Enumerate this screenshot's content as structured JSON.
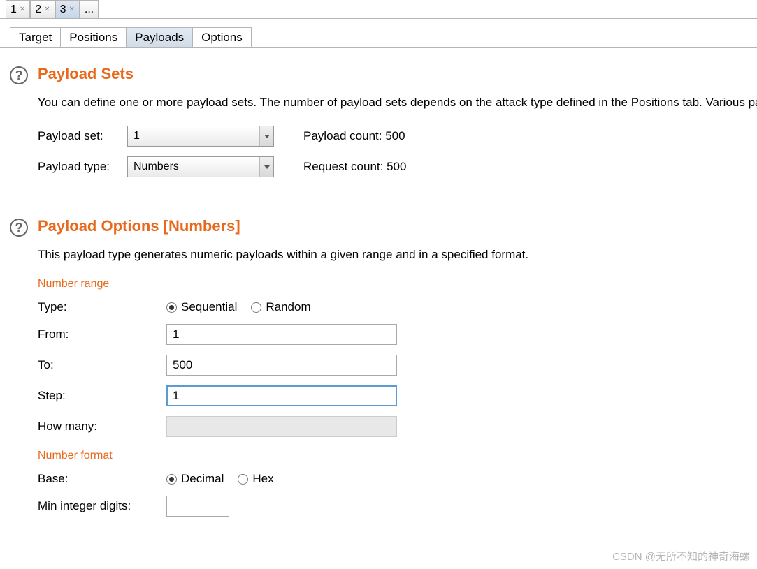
{
  "topTabs": [
    {
      "label": "1",
      "active": false,
      "close": true
    },
    {
      "label": "2",
      "active": false,
      "close": true
    },
    {
      "label": "3",
      "active": true,
      "close": true
    },
    {
      "label": "...",
      "active": false,
      "close": false
    }
  ],
  "subTabs": {
    "target": "Target",
    "positions": "Positions",
    "payloads": "Payloads",
    "options": "Options"
  },
  "payloadSets": {
    "heading": "Payload Sets",
    "desc": "You can define one or more payload sets. The number of payload sets depends on the attack type defined in the Positions tab. Various payload types are available for each payload set, and each payload type can be customized in different ways.",
    "setLabel": "Payload set:",
    "setValue": "1",
    "typeLabel": "Payload type:",
    "typeValue": "Numbers",
    "payloadCountLabel": "Payload count:",
    "payloadCountValue": "500",
    "requestCountLabel": "Request count:",
    "requestCountValue": "500"
  },
  "payloadOptions": {
    "heading": "Payload Options [Numbers]",
    "desc": "This payload type generates numeric payloads within a given range and in a specified format.",
    "rangeHeading": "Number range",
    "typeLabel": "Type:",
    "radioSequential": "Sequential",
    "radioRandom": "Random",
    "fromLabel": "From:",
    "fromValue": "1",
    "toLabel": "To:",
    "toValue": "500",
    "stepLabel": "Step:",
    "stepValue": "1",
    "howManyLabel": "How many:",
    "howManyValue": "",
    "formatHeading": "Number format",
    "baseLabel": "Base:",
    "radioDecimal": "Decimal",
    "radioHex": "Hex",
    "minDigitsLabel": "Min integer digits:",
    "minDigitsValue": ""
  },
  "watermark": "CSDN @无所不知的神奇海螺"
}
